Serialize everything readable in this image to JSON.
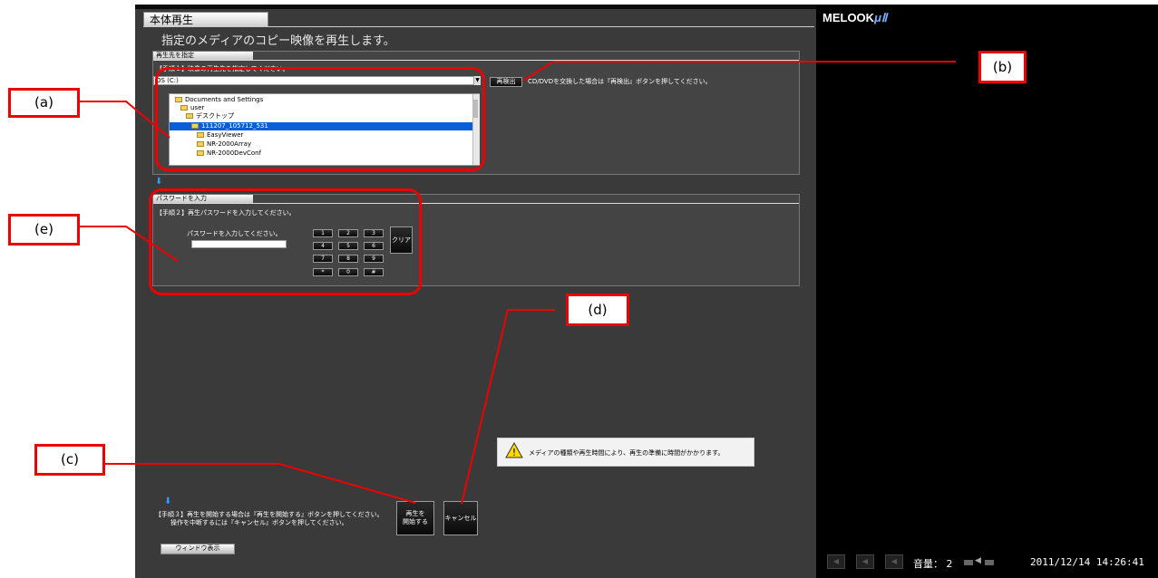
{
  "app": {
    "title": "本体再生",
    "subtitle": "指定のメディアのコピー映像を再生します。",
    "brand": "MELOOK",
    "brand_suffix": "μⅡ"
  },
  "panel1": {
    "header": "再生先を指定",
    "step": "【手順１】映像の再生先を指定してください。",
    "drive": "OS (C:)",
    "redetect_label": "再検出",
    "redetect_note": "CD/DVDを交換した場合は『再検出』ボタンを押してください。",
    "tree": [
      "Documents and Settings",
      "user",
      "デスクトップ",
      "111207_105712_531",
      "EasyViewer",
      "NR-2000Array",
      "NR-2000DevConf"
    ]
  },
  "panel2": {
    "header": "パスワードを入力",
    "step": "【手順２】再生パスワードを入力してください。",
    "prompt": "パスワードを入力してください。",
    "keys": [
      "1",
      "2",
      "3",
      "4",
      "5",
      "6",
      "7",
      "8",
      "9",
      "*",
      "0",
      "#"
    ],
    "clear_label": "クリア"
  },
  "warning": {
    "text": "メディアの種類や再生時間により、再生の準備に時間がかかります。"
  },
  "step3": {
    "line1": "【手順３】再生を開始する場合は『再生を開始する』ボタンを押してください。",
    "line2": "操作を中断するには『キャンセル』ボタンを押してください。",
    "start_label_1": "再生を",
    "start_label_2": "開始する",
    "cancel_label": "キャンセル",
    "window_label": "ウィンドウ表示"
  },
  "status": {
    "volume_label": "音量：",
    "volume_value": "2",
    "datetime": "2011/12/14 14:26:41"
  },
  "callouts": {
    "a": "(a)",
    "b": "(b)",
    "c": "(c)",
    "d": "(d)",
    "e": "(e)"
  }
}
